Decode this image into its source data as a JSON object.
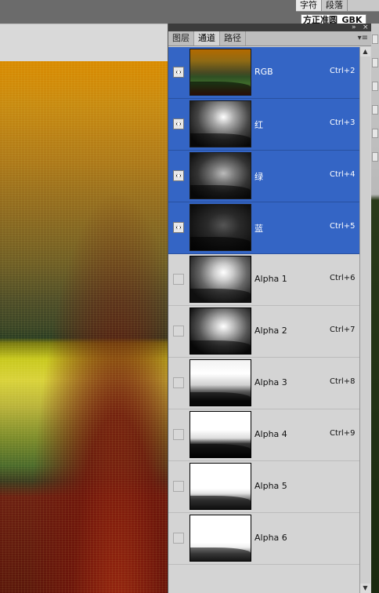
{
  "character_panel": {
    "tabs": [
      "字符",
      "段落"
    ],
    "font_value": "方正准圆_GBK"
  },
  "channels_panel": {
    "tabs": [
      "图层",
      "通道",
      "路径"
    ],
    "active_tab": "通道",
    "channels": [
      {
        "name": "RGB",
        "shortcut": "Ctrl+2"
      },
      {
        "name": "红",
        "shortcut": "Ctrl+3"
      },
      {
        "name": "绿",
        "shortcut": "Ctrl+4"
      },
      {
        "name": "蓝",
        "shortcut": "Ctrl+5"
      },
      {
        "name": "Alpha 1",
        "shortcut": "Ctrl+6"
      },
      {
        "name": "Alpha 2",
        "shortcut": "Ctrl+7"
      },
      {
        "name": "Alpha 3",
        "shortcut": "Ctrl+8"
      },
      {
        "name": "Alpha 4",
        "shortcut": "Ctrl+9"
      },
      {
        "name": "Alpha 5",
        "shortcut": ""
      },
      {
        "name": "Alpha 6",
        "shortcut": ""
      }
    ],
    "icons": {
      "visibility": "eye-icon",
      "panel_menu": "panel-menu-icon",
      "collapse": "double-arrow-icon",
      "close": "close-icon"
    },
    "colors": {
      "selection": "#3465c5",
      "panel_bg": "#d4d4d4"
    }
  }
}
